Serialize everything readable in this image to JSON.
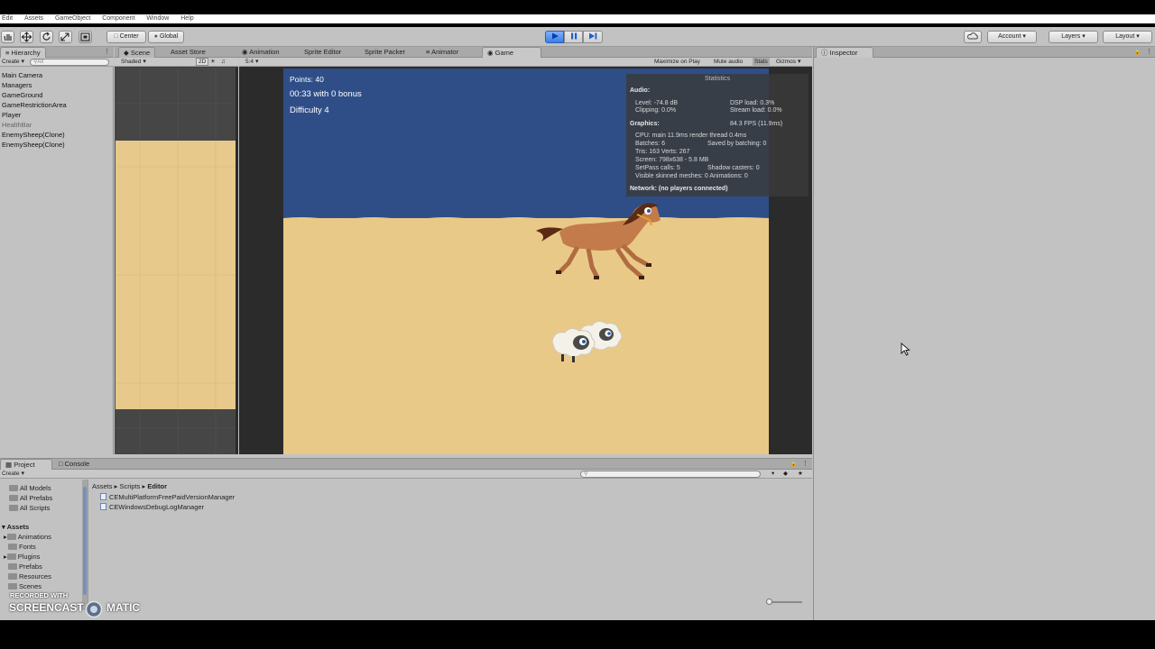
{
  "menubar": {
    "items": [
      "Edit",
      "Assets",
      "GameObject",
      "Component",
      "Window",
      "Help"
    ]
  },
  "toolbar": {
    "center_label": "Center",
    "global_label": "Global",
    "account_label": "Account",
    "layers_label": "Layers",
    "layout_label": "Layout"
  },
  "hierarchy": {
    "tab_label": "Hierarchy",
    "create_label": "Create",
    "search_placeholder": "All",
    "items": [
      "Main Camera",
      "Managers",
      "GameGround",
      "GameRestrictionArea",
      "Player",
      "HealthBar",
      "EnemySheep(Clone)",
      "EnemySheep(Clone)"
    ]
  },
  "center_tabs": [
    {
      "label": "Scene",
      "active": false
    },
    {
      "label": "Asset Store",
      "active": false
    },
    {
      "label": "Animation",
      "active": false
    },
    {
      "label": "Sprite Editor",
      "active": false
    },
    {
      "label": "Sprite Packer",
      "active": false
    },
    {
      "label": "Animator",
      "active": false
    },
    {
      "label": "Game",
      "active": true
    }
  ],
  "scene_toolbar": {
    "shaded_label": "Shaded",
    "mode_2d_label": "2D"
  },
  "game_toolbar": {
    "aspect_label": "5:4",
    "maximize_label": "Maximize on Play",
    "mute_label": "Mute audio",
    "stats_label": "Stats",
    "gizmos_label": "Gizmos"
  },
  "game_hud": {
    "points": "Points: 40",
    "timer": "00:33 with 0 bonus",
    "difficulty": "Difficulty 4"
  },
  "statistics": {
    "title": "Statistics",
    "audio_header": "Audio:",
    "level": "Level: -74.8 dB",
    "clipping": "Clipping: 0.0%",
    "dsp_load": "DSP load: 0.3%",
    "stream_load": "Stream load: 0.0%",
    "graphics_header": "Graphics:",
    "fps": "84.3 FPS (11.9ms)",
    "cpu": "CPU: main 11.9ms  render thread 0.4ms",
    "batches": "Batches: 6",
    "saved_batching": "Saved by batching: 0",
    "tris": "Tris: 163  Verts: 267",
    "screen": "Screen: 798x638 - 5.8 MB",
    "setpass": "SetPass calls: 5",
    "shadow_casters": "Shadow casters: 0",
    "skinned": "Visible skinned meshes: 0  Animations: 0",
    "network": "Network: (no players connected)"
  },
  "inspector": {
    "tab_label": "Inspector"
  },
  "project": {
    "tab_label": "Project",
    "console_label": "Console",
    "create_label": "Create",
    "favorites": [
      "All Models",
      "All Prefabs",
      "All Scripts"
    ],
    "assets_header": "Assets",
    "folders": [
      "Animations",
      "Fonts",
      "Plugins",
      "Prefabs",
      "Resources",
      "Scenes"
    ],
    "breadcrumb": [
      "Assets",
      "Scripts",
      "Editor"
    ],
    "files": [
      "CEMultiPlatformFreePaidVersionManager",
      "CEWindowsDebugLogManager"
    ]
  },
  "watermark": {
    "recorded": "RECORDED WITH",
    "brand_left": "SCREENCAST",
    "brand_right": "MATIC"
  },
  "colors": {
    "sky": "#2f4e87",
    "sand": "#e9c987",
    "editor_bg": "#c2c2c2",
    "stats_bg": "#3a3a3a",
    "play_active": "#3a7ee8"
  }
}
